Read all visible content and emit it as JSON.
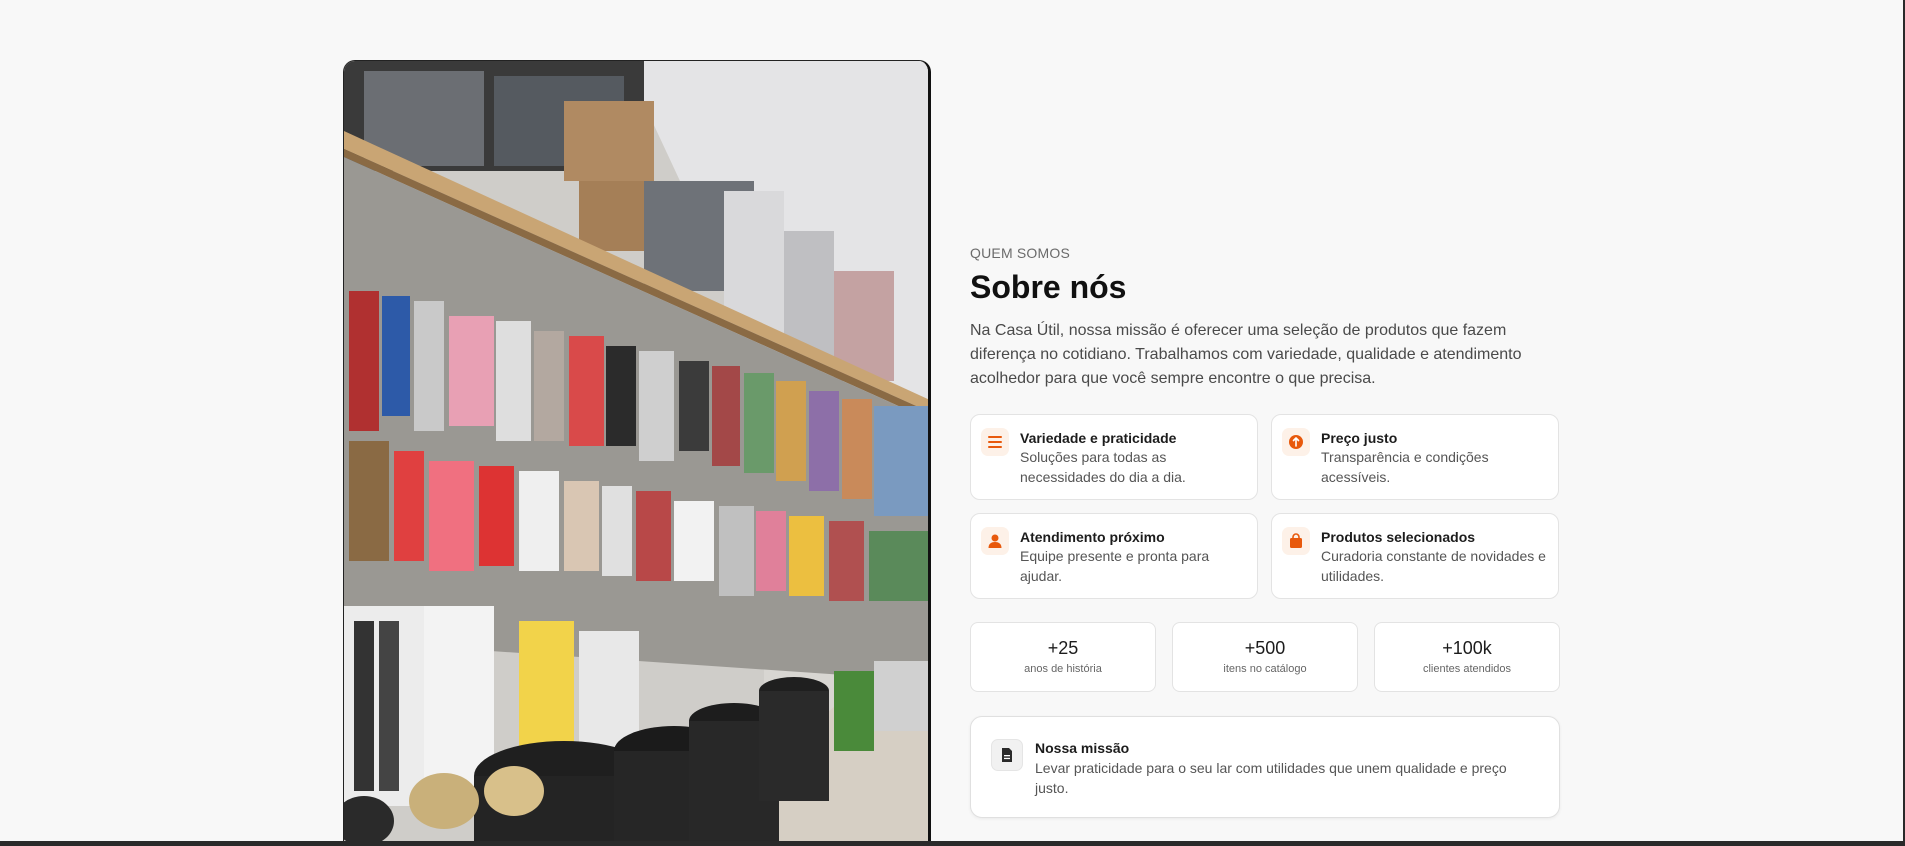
{
  "about": {
    "eyebrow": "QUEM SOMOS",
    "title": "Sobre nós",
    "lead": "Na Casa Útil, nossa missão é oferecer uma seleção de produtos que fazem diferença no cotidiano. Trabalhamos com variedade, qualidade e atendimento acolhedor para que você sempre encontre o que precisa."
  },
  "features": [
    {
      "icon": "list-icon",
      "title": "Variedade e praticidade",
      "desc": "Soluções para todas as necessidades do dia a dia."
    },
    {
      "icon": "price-tag-icon",
      "title": "Preço justo",
      "desc": "Transparência e condições acessíveis."
    },
    {
      "icon": "user-icon",
      "title": "Atendimento próximo",
      "desc": "Equipe presente e pronta para ajudar."
    },
    {
      "icon": "shopping-bag-icon",
      "title": "Produtos selecionados",
      "desc": "Curadoria constante de novidades e utilidades."
    }
  ],
  "stats": [
    {
      "value": "+25",
      "label": "anos de história"
    },
    {
      "value": "+500",
      "label": "itens no catálogo"
    },
    {
      "value": "+100k",
      "label": "clientes atendidos"
    }
  ],
  "mission": {
    "icon": "document-icon",
    "title": "Nossa missão",
    "desc": "Levar praticidade para o seu lar com utilidades que unem qualidade e preço justo."
  },
  "colors": {
    "accent": "#e8590c",
    "accent_bg": "#fdf1e8",
    "page_bg": "#f8f8f8"
  },
  "store_photo": {
    "icon": "store-photo"
  }
}
